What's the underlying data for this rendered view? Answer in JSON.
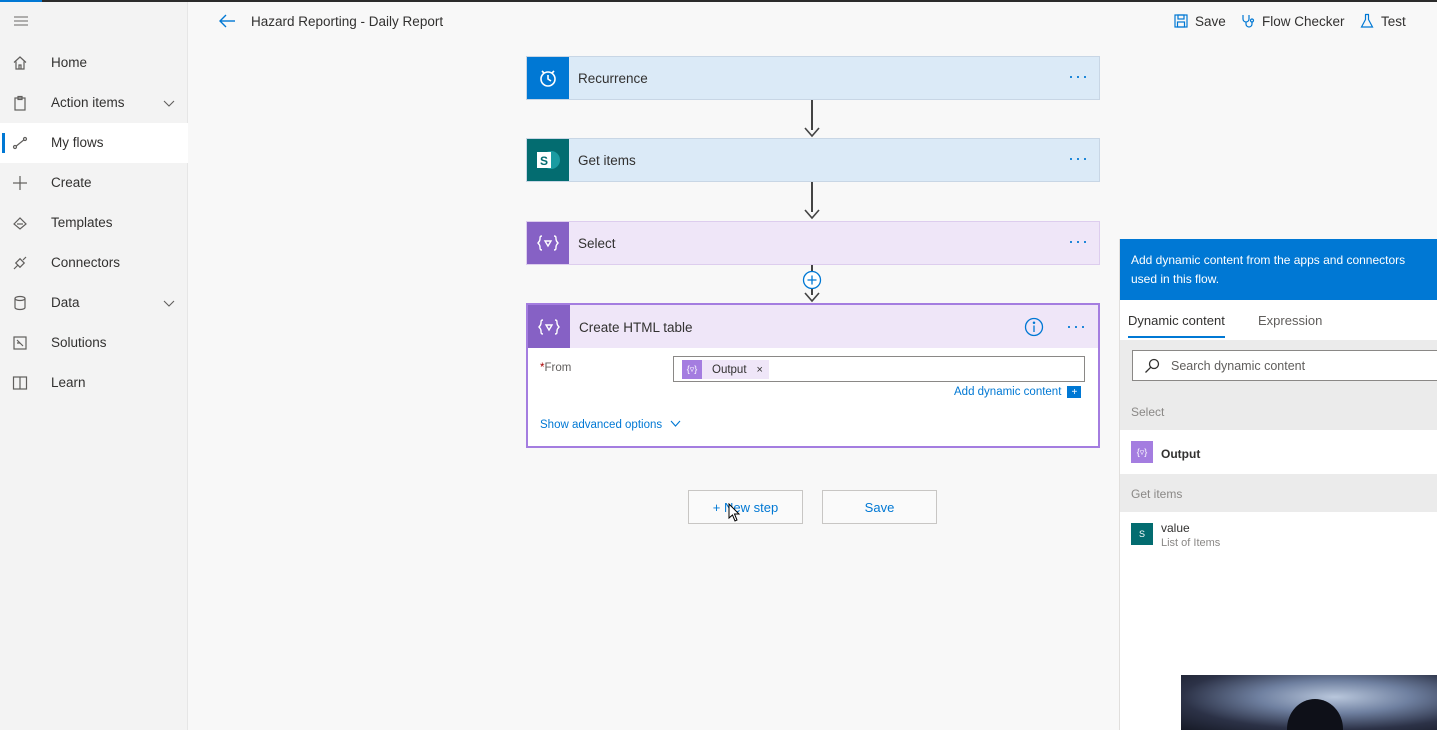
{
  "header": {
    "title": "Hazard Reporting - Daily Report",
    "save": "Save",
    "flow_checker": "Flow Checker",
    "test": "Test"
  },
  "sidebar": {
    "items": [
      {
        "label": "Home",
        "icon": "home-icon"
      },
      {
        "label": "Action items",
        "icon": "clipboard-icon",
        "expandable": true
      },
      {
        "label": "My flows",
        "icon": "flow-icon",
        "active": true
      },
      {
        "label": "Create",
        "icon": "plus-icon"
      },
      {
        "label": "Templates",
        "icon": "templates-icon"
      },
      {
        "label": "Connectors",
        "icon": "connector-icon"
      },
      {
        "label": "Data",
        "icon": "database-icon",
        "expandable": true
      },
      {
        "label": "Solutions",
        "icon": "solutions-icon"
      },
      {
        "label": "Learn",
        "icon": "book-icon"
      }
    ]
  },
  "flow": {
    "steps": [
      {
        "name": "Recurrence",
        "icon": "clock-icon",
        "color": "#0078d4"
      },
      {
        "name": "Get items",
        "icon": "sharepoint-icon",
        "color": "#036c70"
      },
      {
        "name": "Select",
        "icon": "data-operation-icon",
        "color": "#8661c5"
      }
    ],
    "active_step": {
      "name": "Create HTML table",
      "from_label": "From",
      "required_mark": "*",
      "token": "Output",
      "add_dynamic": "Add dynamic content",
      "advanced": "Show advanced options"
    },
    "new_step": "+ New step",
    "save": "Save"
  },
  "panel": {
    "heading": "Add dynamic content from the apps and connectors used in this flow.",
    "tabs": [
      "Dynamic content",
      "Expression"
    ],
    "search_placeholder": "Search dynamic content",
    "sections": [
      {
        "title": "Select",
        "items": [
          {
            "name": "Output",
            "sub": ""
          }
        ]
      },
      {
        "title": "Get items",
        "items": [
          {
            "name": "value",
            "sub": "List of Items"
          }
        ]
      }
    ]
  },
  "colors": {
    "accent": "#0078d4",
    "purple": "#8661c5",
    "sharepoint": "#036c70"
  }
}
